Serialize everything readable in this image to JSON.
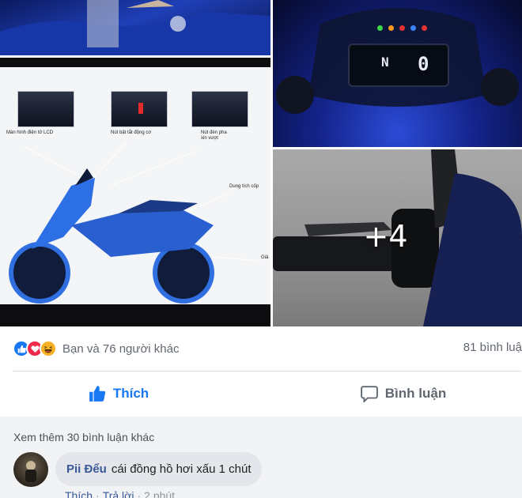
{
  "gallery": {
    "more_count_label": "+4",
    "dashboard": {
      "gear": "N",
      "speed": "0"
    },
    "slide_callouts": [
      "Màn hình điện tử LCD",
      "Nút bật tắt động cơ",
      "Nút đèn pha xin vượt",
      "Dung tích cốp",
      "Giả"
    ]
  },
  "reactions": {
    "icons": [
      "like-icon",
      "love-icon",
      "haha-icon"
    ],
    "summary": "Bạn và 76 người khác",
    "comments_count": "81 bình luậ"
  },
  "actions": {
    "like_label": "Thích",
    "comment_label": "Bình luận"
  },
  "comments": {
    "view_more": "Xem thêm 30 bình luận khác",
    "items": [
      {
        "author": "Pii Đểu",
        "text": "cái đồng hồ hơi xấu 1 chút",
        "like": "Thích",
        "reply": "Trả lời",
        "time": "2 phút"
      }
    ]
  },
  "colors": {
    "accent": "#1877f2",
    "like_icon": "#1877f2",
    "love_icon": "#f0284a",
    "haha_icon": "#f7b125",
    "author_link": "#385898"
  }
}
